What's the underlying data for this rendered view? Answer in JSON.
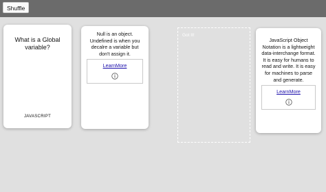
{
  "toolbar": {
    "shuffle_label": "Shuffle"
  },
  "cards": [
    {
      "question": "What is a Global variable?",
      "category": "JAVASCRIPT"
    },
    {
      "answer": "Null is an object. Undefined is when you decalre a variable but don't assign it.",
      "link_label": "LearnMore",
      "icon": "info-icon"
    },
    {
      "answer": "JavaScript Object Notation is a lightweight data-interchange format. It is easy for humans to read and write. It is easy for machines to parse and generate.",
      "link_label": "LearnMore",
      "icon": "info-icon"
    }
  ],
  "drop_zone": {
    "label": "Got It!"
  },
  "colors": {
    "top_bar": "#6b6b6b",
    "background": "#e0e0e0",
    "card": "#ffffff",
    "link": "#1a0dab"
  }
}
